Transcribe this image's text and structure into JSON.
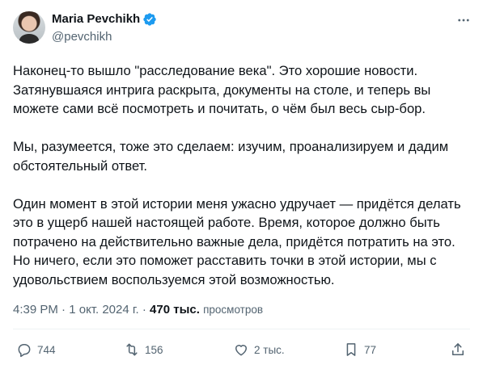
{
  "author": {
    "name": "Maria Pevchikh",
    "handle": "@pevchikh",
    "verified": true
  },
  "tweet": {
    "paragraphs": [
      "Наконец-то вышло \"расследование века\". Это хорошие новости. Затянувшаяся интрига раскрыта, документы на столе, и теперь вы можете сами всё посмотреть и почитать, о чём был весь сыр-бор.",
      "Мы, разумеется, тоже это сделаем: изучим, проанализируем и дадим обстоятельный ответ.",
      "Один момент в этой истории меня ужасно удручает — придётся делать это в ущерб нашей настоящей работе. Время, которое должно быть потрачено на действительно важные дела, придётся потратить на это. Но ничего, если это поможет расставить точки в этой истории, мы с удовольствием воспользуемся этой возможностью."
    ],
    "time": "4:39 PM",
    "separator": "·",
    "date": "1 окт. 2024 г.",
    "views_count": "470 тыс.",
    "views_label": "просмотров"
  },
  "actions": {
    "replies": "744",
    "reposts": "156",
    "likes": "2 тыс.",
    "bookmarks": "77"
  },
  "icons": [
    "verified-badge-icon",
    "more-icon",
    "reply-icon",
    "retweet-icon",
    "like-icon",
    "bookmark-icon",
    "share-icon"
  ],
  "colors": {
    "verified": "#1d9bf0",
    "text": "#0f1419",
    "secondary": "#536471"
  }
}
